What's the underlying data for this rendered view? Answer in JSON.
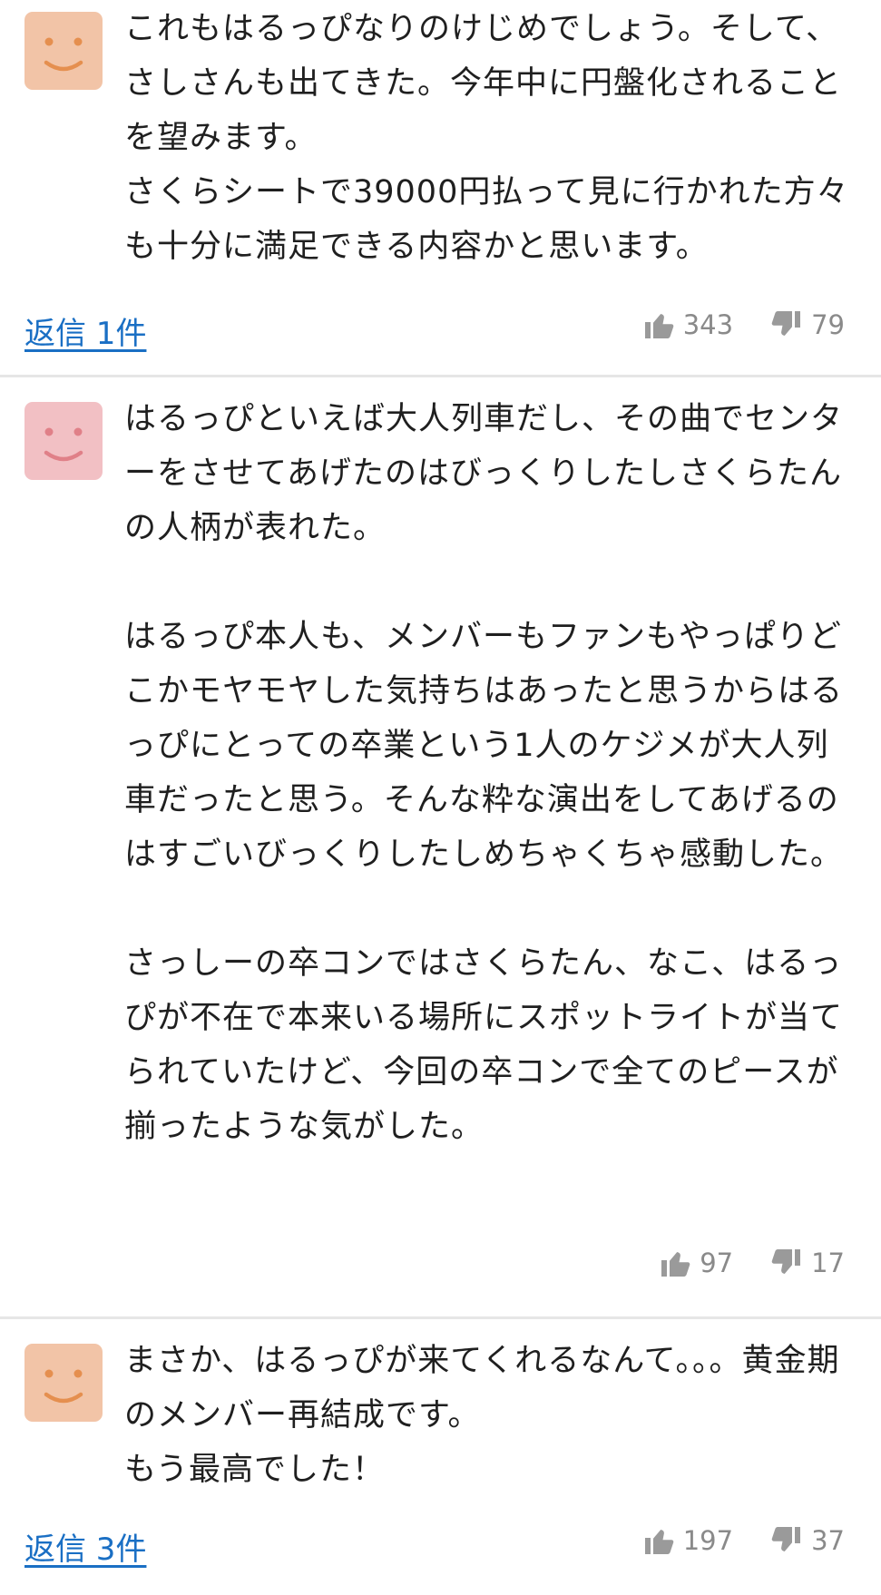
{
  "comments": [
    {
      "avatar_color": "#f2c4a7",
      "avatar_face_color": "#e58f4f",
      "paragraphs": [
        "これもはるっぴなりのけじめでしょう。そして、さしさんも出てきた。今年中に円盤化されることを望みます。\nさくらシートで39000円払って見に行かれた方々も十分に満足できる内容かと思います。"
      ],
      "reply_label": "返信 1件",
      "likes": "343",
      "dislikes": "79"
    },
    {
      "avatar_color": "#f2c0c4",
      "avatar_face_color": "#e08088",
      "paragraphs": [
        "はるっぴといえば大人列車だし、その曲でセンターをさせてあげたのはびっくりしたしさくらたんの人柄が表れた。",
        "はるっぴ本人も、メンバーもファンもやっぱりどこかモヤモヤした気持ちはあったと思うからはるっぴにとっての卒業という1人のケジメが大人列車だったと思う。そんな粋な演出をしてあげるのはすごいびっくりしたしめちゃくちゃ感動した。",
        "さっしーの卒コンではさくらたん、なこ、はるっぴが不在で本来いる場所にスポットライトが当てられていたけど、今回の卒コンで全てのピースが揃ったような気がした。"
      ],
      "reply_label": "",
      "likes": "97",
      "dislikes": "17"
    },
    {
      "avatar_color": "#f2c4a7",
      "avatar_face_color": "#e58f4f",
      "paragraphs": [
        "まさか、はるっぴが来てくれるなんて。。。黄金期のメンバー再結成です。\nもう最高でした！"
      ],
      "reply_label": "返信 3件",
      "likes": "197",
      "dislikes": "37"
    }
  ]
}
